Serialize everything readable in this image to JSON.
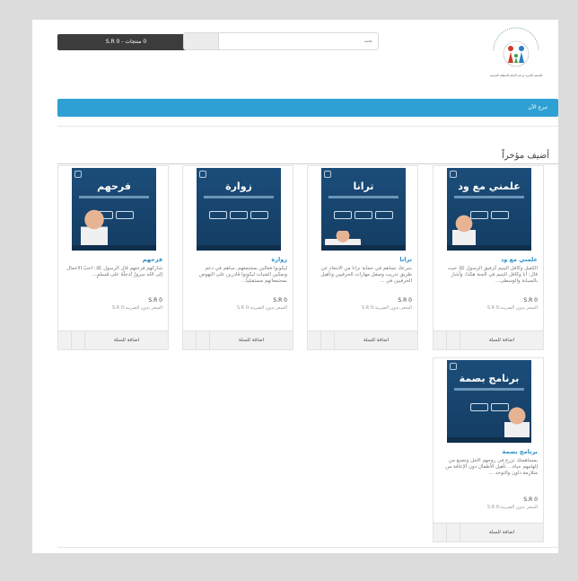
{
  "header": {
    "cart_label": "0 منتجات - S.R 0",
    "search_placeholder": "بحث",
    "logo_text": "الجمعية الخيرية لرعاية الأيتام بالمنطقة الشرقية"
  },
  "nav": {
    "label": "تبرع الآن"
  },
  "section": {
    "title": "أضيف مؤخراً"
  },
  "add_to_cart_label": "اضافة للسلة",
  "price_note_label": "السعر بدون الضريبة:S.R 0",
  "colors": {
    "nav": "#2fa0d3",
    "cart": "#3c3c3c",
    "product_name": "#2a8fc6"
  },
  "products": [
    {
      "name": "علمني مع ود",
      "thumb_title": "علمني مع ود",
      "desc": "الكفيل وكافل اليتيم كرفيق الرسول ﷺ حيث قال: أنا وكافل اليتيم في الجنة هكذا، وأشار بالسبابة والوسطى...",
      "price": "S.R 0"
    },
    {
      "name": "ترانا",
      "thumb_title": "ترانا",
      "desc": "بتبرعك تساهم في حماية ترانا من الابتعاد عن طريق تدريب وصقل مهارات الحرفيين وتأهيل الحرفيين في ...",
      "price": "S.R 0"
    },
    {
      "name": "زوارة",
      "thumb_title": "زوارة",
      "desc": "ليكونوا فعالين بمجتمعهم..ساهم في دعم وتمكين الفتيات ليكونوا قادرين على النهوض بمجتمعاتهم مستقبلياً...",
      "price": "S.R 0"
    },
    {
      "name": "فرحهم",
      "thumb_title": "فرحهم",
      "desc": "شاركهم فرحتهم قال الرسول ﷺ: أحبُّ الأعمال إلى الله سرورٌ تُدخِلُهُ على مُسلمٍ...",
      "price": "S.R 0"
    },
    {
      "name": "برنامج بصمة",
      "thumb_title": "برنامج بصمة",
      "desc": "بمساهمتك تزرع في روحهم الأمل وتصنع من إلهامهم حياة... تأهيل الأطفال دون الإعاقة من متلازمة داون والتوحد ...",
      "price": "S.R 0"
    }
  ]
}
